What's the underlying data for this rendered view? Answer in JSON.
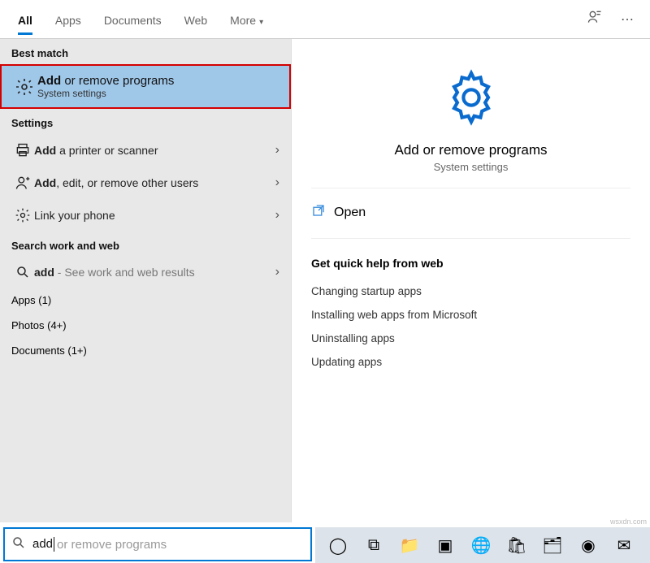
{
  "tabs": {
    "items": [
      "All",
      "Apps",
      "Documents",
      "Web",
      "More"
    ],
    "active": "All"
  },
  "header_icons": {
    "feedback": "feedback",
    "more": "more"
  },
  "left": {
    "best_match_hdr": "Best match",
    "best_match": {
      "title_bold": "Add",
      "title_rest": " or remove programs",
      "sub": "System settings",
      "icon": "gear-icon"
    },
    "settings_hdr": "Settings",
    "settings": [
      {
        "icon": "printer-icon",
        "bold": "Add",
        "rest": " a printer or scanner"
      },
      {
        "icon": "person-icon",
        "bold": "Add",
        "rest": ", edit, or remove other users"
      },
      {
        "icon": "gear-icon",
        "bold": "",
        "rest": "Link your phone"
      }
    ],
    "search_web_hdr": "Search work and web",
    "search_web": {
      "icon": "search-icon",
      "bold": "add",
      "rest": " - See work and web results"
    },
    "counts": [
      {
        "label": "Apps",
        "n": "(1)"
      },
      {
        "label": "Photos",
        "n": "(4+)"
      },
      {
        "label": "Documents",
        "n": "(1+)"
      }
    ]
  },
  "right": {
    "title": "Add or remove programs",
    "sub": "System settings",
    "action_label": "Open",
    "action_icon": "open-icon",
    "help_hdr": "Get quick help from web",
    "help_items": [
      "Changing startup apps",
      "Installing web apps from Microsoft",
      "Uninstalling apps",
      "Updating apps"
    ]
  },
  "search": {
    "value": "add",
    "placeholder": " or remove programs"
  },
  "taskbar": {
    "items": [
      {
        "name": "cortana-icon",
        "glyph": "◯"
      },
      {
        "name": "taskview-icon",
        "glyph": "⧉"
      },
      {
        "name": "explorer-icon",
        "glyph": "📁"
      },
      {
        "name": "app-icon",
        "glyph": "▣"
      },
      {
        "name": "edge-icon",
        "glyph": "🌐"
      },
      {
        "name": "store-icon",
        "glyph": "🛍"
      },
      {
        "name": "files-icon",
        "glyph": "🗂"
      },
      {
        "name": "chrome-icon",
        "glyph": "◉"
      },
      {
        "name": "mail-icon",
        "glyph": "✉"
      }
    ]
  },
  "watermark": "wsxdn.com"
}
